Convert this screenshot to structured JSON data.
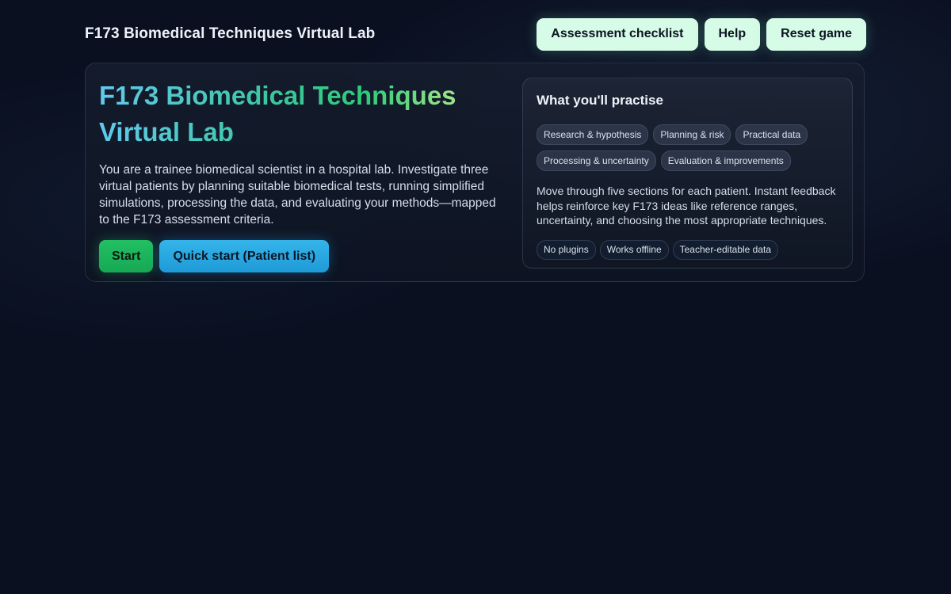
{
  "header": {
    "title": "F173 Biomedical Techniques Virtual Lab",
    "buttons": {
      "checklist": "Assessment checklist",
      "help": "Help",
      "reset": "Reset game"
    }
  },
  "hero": {
    "title_line1": "F173 Biomedical Techniques",
    "title_line2": "Virtual Lab",
    "description": "You are a trainee biomedical scientist in a hospital lab. Investigate three virtual patients by planning suitable biomedical tests, running simplified simulations, processing the data, and evaluating your methods—mapped to the F173 assessment criteria.",
    "start_label": "Start",
    "quick_start_label": "Quick start (Patient list)"
  },
  "practise": {
    "title": "What you'll practise",
    "chips": [
      "Research & hypothesis",
      "Planning & risk",
      "Practical data",
      "Processing & uncertainty",
      "Evaluation & improvements"
    ],
    "description": "Move through five sections for each patient. Instant feedback helps reinforce key F173 ideas like reference ranges, uncertainty, and choosing the most appropriate techniques.",
    "tags": [
      "No plugins",
      "Works offline",
      "Teacher-editable data"
    ]
  },
  "colors": {
    "background": "#0a1020",
    "top_button": "#d6fbe6",
    "start_button": "#22c063",
    "quick_button": "#35b4ea"
  }
}
